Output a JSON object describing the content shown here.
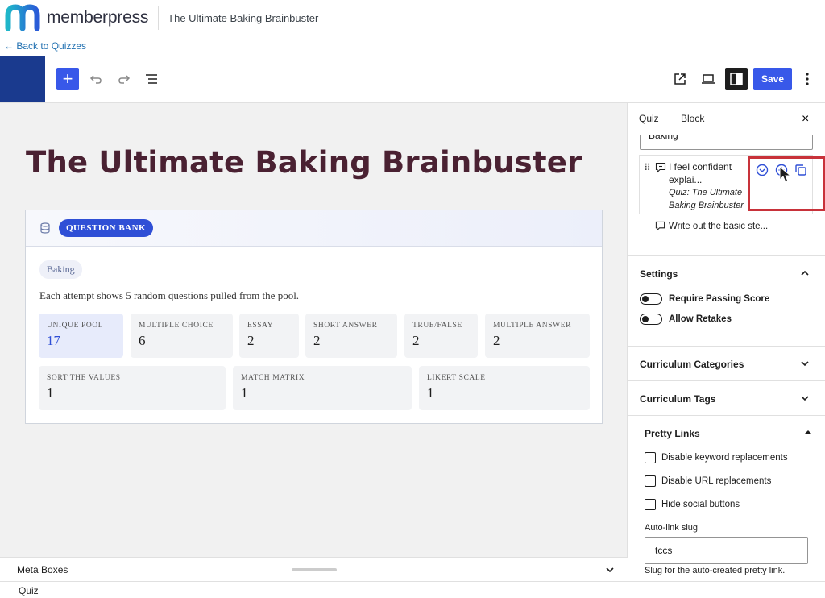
{
  "brand": {
    "logo_text": "memberpress",
    "page_title": "The Ultimate Baking Brainbuster",
    "back_link": "← Back to Quizzes"
  },
  "toolbar": {
    "add_label": "+",
    "save_label": "Save",
    "more_label": "⋮"
  },
  "canvas": {
    "title": "The Ultimate Baking Brainbuster",
    "question_bank": {
      "badge": "QUESTION BANK",
      "tag": "Baking",
      "description": "Each attempt shows 5 random questions pulled from the pool.",
      "stats": [
        {
          "label": "UNIQUE POOL",
          "value": "17"
        },
        {
          "label": "MULTIPLE CHOICE",
          "value": "6"
        },
        {
          "label": "ESSAY",
          "value": "2"
        },
        {
          "label": "SHORT ANSWER",
          "value": "2"
        },
        {
          "label": "TRUE/FALSE",
          "value": "2"
        },
        {
          "label": "MULTIPLE ANSWER",
          "value": "2"
        },
        {
          "label": "SORT THE VALUES",
          "value": "1"
        },
        {
          "label": "MATCH MATRIX",
          "value": "1"
        },
        {
          "label": "LIKERT SCALE",
          "value": "1"
        }
      ]
    }
  },
  "meta": {
    "label": "Meta Boxes",
    "footer": "Quiz"
  },
  "sidebar": {
    "tabs": {
      "quiz": "Quiz",
      "block": "Block"
    },
    "close": "×",
    "filter_value": "Baking",
    "question": {
      "title": "I feel confident explai...",
      "meta": "Quiz: The Ultimate Baking Brainbuster"
    },
    "sub_item": "Write out the basic ste...",
    "settings": {
      "title": "Settings",
      "toggles": [
        "Require Passing Score",
        "Allow Retakes"
      ]
    },
    "curriculum_categories": "Curriculum Categories",
    "curriculum_tags": "Curriculum Tags",
    "pretty_links": {
      "title": "Pretty Links",
      "checkboxes": [
        "Disable keyword replacements",
        "Disable URL replacements",
        "Hide social buttons"
      ],
      "slug_label": "Auto-link slug",
      "slug_value": "tccs",
      "slug_help": "Slug for the auto-created pretty link."
    }
  },
  "colors": {
    "accent": "#3858e9",
    "title": "#4a2132",
    "highlight_box": "#c8323a",
    "site_block": "#1a3a8e"
  }
}
